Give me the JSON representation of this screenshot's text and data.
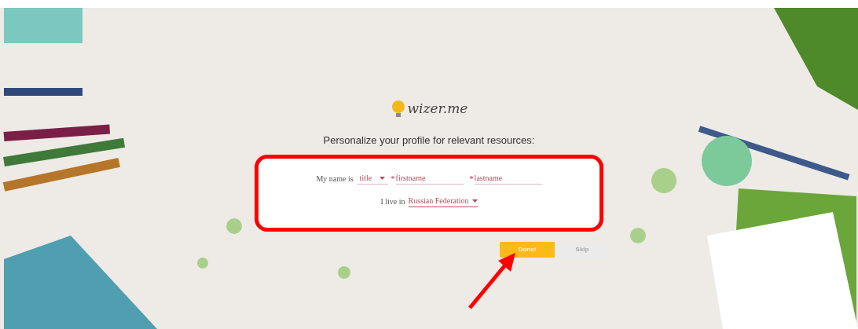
{
  "logo": {
    "text": "wizer.me"
  },
  "heading": "Personalize your profile for relevant resources:",
  "form": {
    "name_label": "My name is",
    "title": {
      "placeholder": "title"
    },
    "firstname": {
      "placeholder": "firstname",
      "required_mark": "*"
    },
    "lastname": {
      "placeholder": "lastname",
      "required_mark": "*"
    },
    "country_label": "I live in",
    "country": {
      "value": "Russian Federation"
    }
  },
  "buttons": [
    {
      "label": "Done!",
      "kind": "primary"
    },
    {
      "label": "Skip",
      "kind": "secondary"
    }
  ]
}
